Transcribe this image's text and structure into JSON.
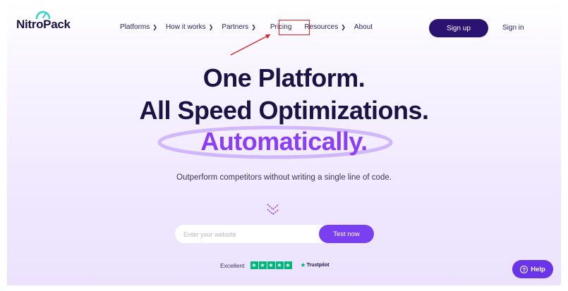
{
  "brand": {
    "name": "NitroPack"
  },
  "nav": {
    "items": [
      {
        "label": "Platforms",
        "has_dropdown": true
      },
      {
        "label": "How it works",
        "has_dropdown": true
      },
      {
        "label": "Partners",
        "has_dropdown": true
      },
      {
        "label": "Pricing",
        "has_dropdown": false
      },
      {
        "label": "Resources",
        "has_dropdown": true
      },
      {
        "label": "About",
        "has_dropdown": false
      }
    ],
    "highlighted_item": "Pricing"
  },
  "header": {
    "signup_label": "Sign up",
    "signin_label": "Sign in"
  },
  "hero": {
    "line1": "One Platform.",
    "line2": "All Speed Optimizations.",
    "line3": "Automatically.",
    "subtitle": "Outperform competitors without writing a single line of code."
  },
  "search": {
    "placeholder": "Enter your website",
    "button_label": "Test now"
  },
  "trust": {
    "rating_text": "Excellent",
    "stars": 5,
    "brand": "Trustpilot"
  },
  "help": {
    "label": "Help"
  },
  "icons": {
    "logo_mark": "speedometer-icon",
    "dropdown": "chevron-down-icon",
    "scroll": "double-chevron-down-icon",
    "star": "star-icon",
    "help": "question-icon"
  },
  "colors": {
    "brand_dark": "#2b1471",
    "accent_purple": "#7b3ff2",
    "highlight_red": "#e02020",
    "trustpilot_green": "#00b67a"
  }
}
